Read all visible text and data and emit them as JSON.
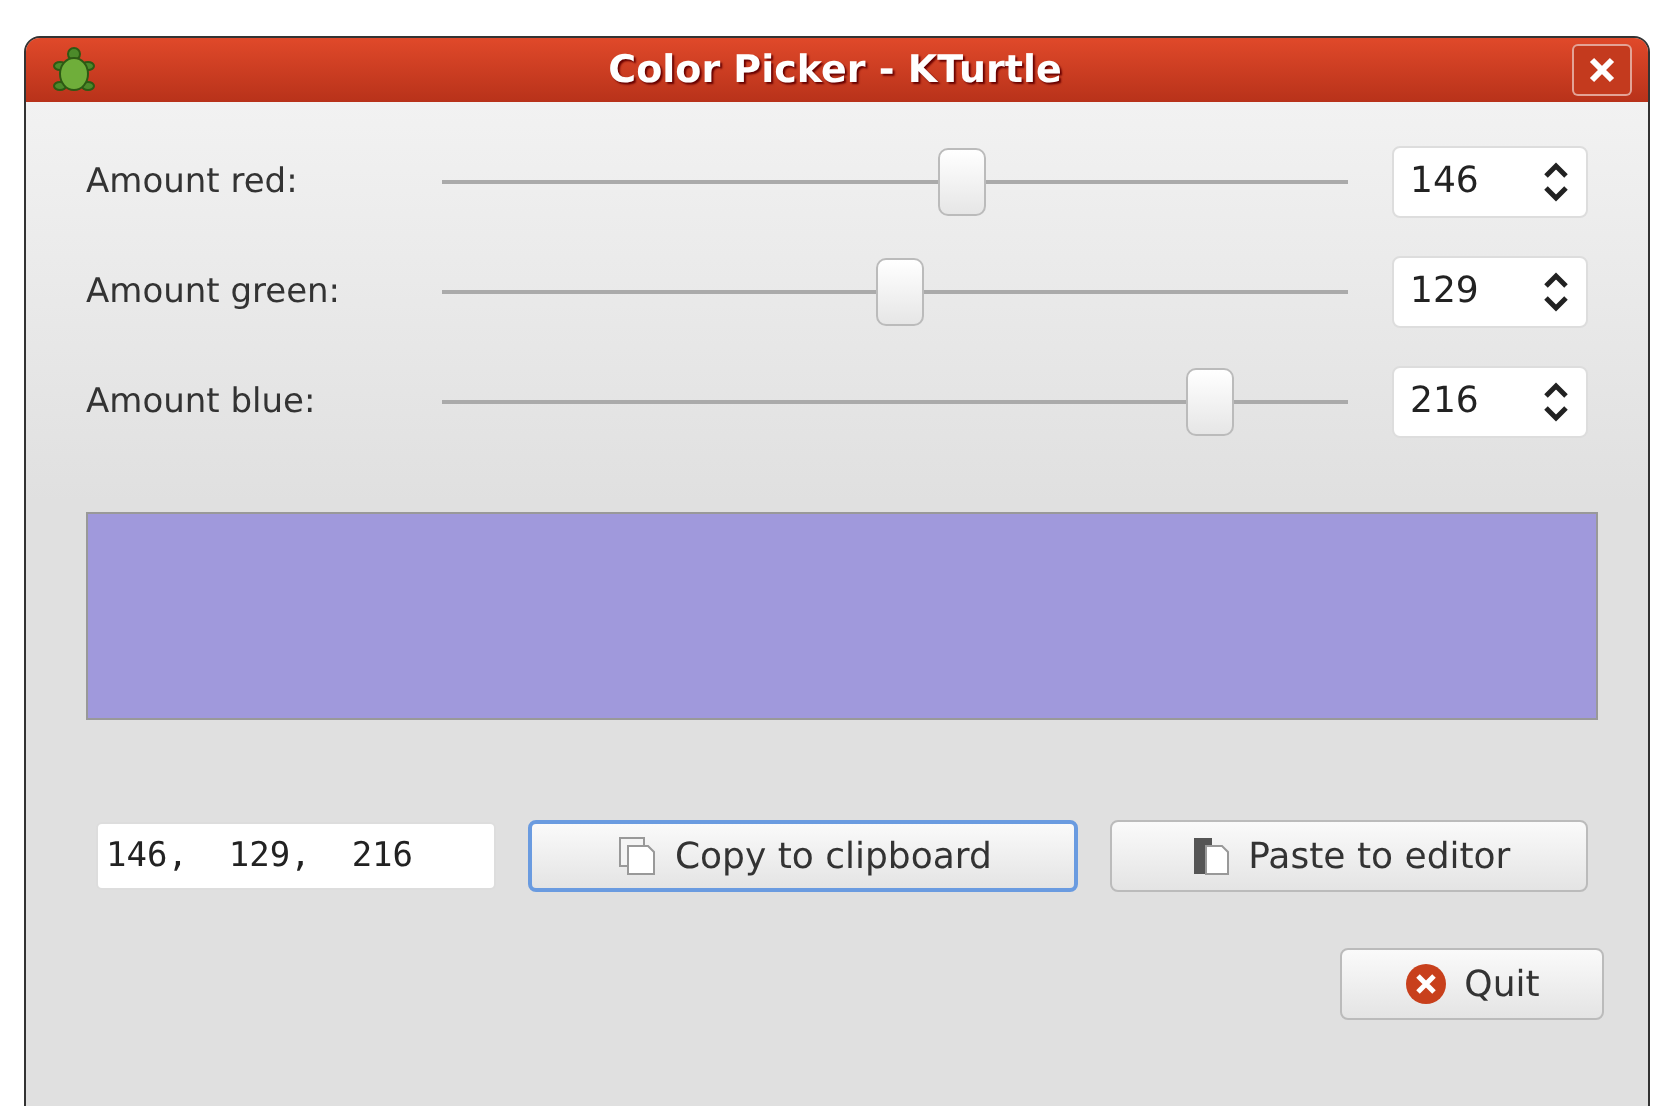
{
  "window": {
    "title": "Color Picker - KTurtle"
  },
  "channels": [
    {
      "label": "Amount red:",
      "level": 0.573,
      "value": "146"
    },
    {
      "label": "Amount green:",
      "level": 0.506,
      "value": "129"
    },
    {
      "label": "Amount blue:",
      "level": 0.847,
      "value": "216"
    }
  ],
  "preview": {
    "color": "#a099dc"
  },
  "code_field": {
    "value": "146,  129,  216"
  },
  "buttons": [
    {
      "label": "Copy to clipboard",
      "kind": "copy",
      "focused": true
    },
    {
      "label": "Paste to editor",
      "kind": "paste",
      "focused": false
    }
  ],
  "quit_button": {
    "label": "Quit"
  }
}
